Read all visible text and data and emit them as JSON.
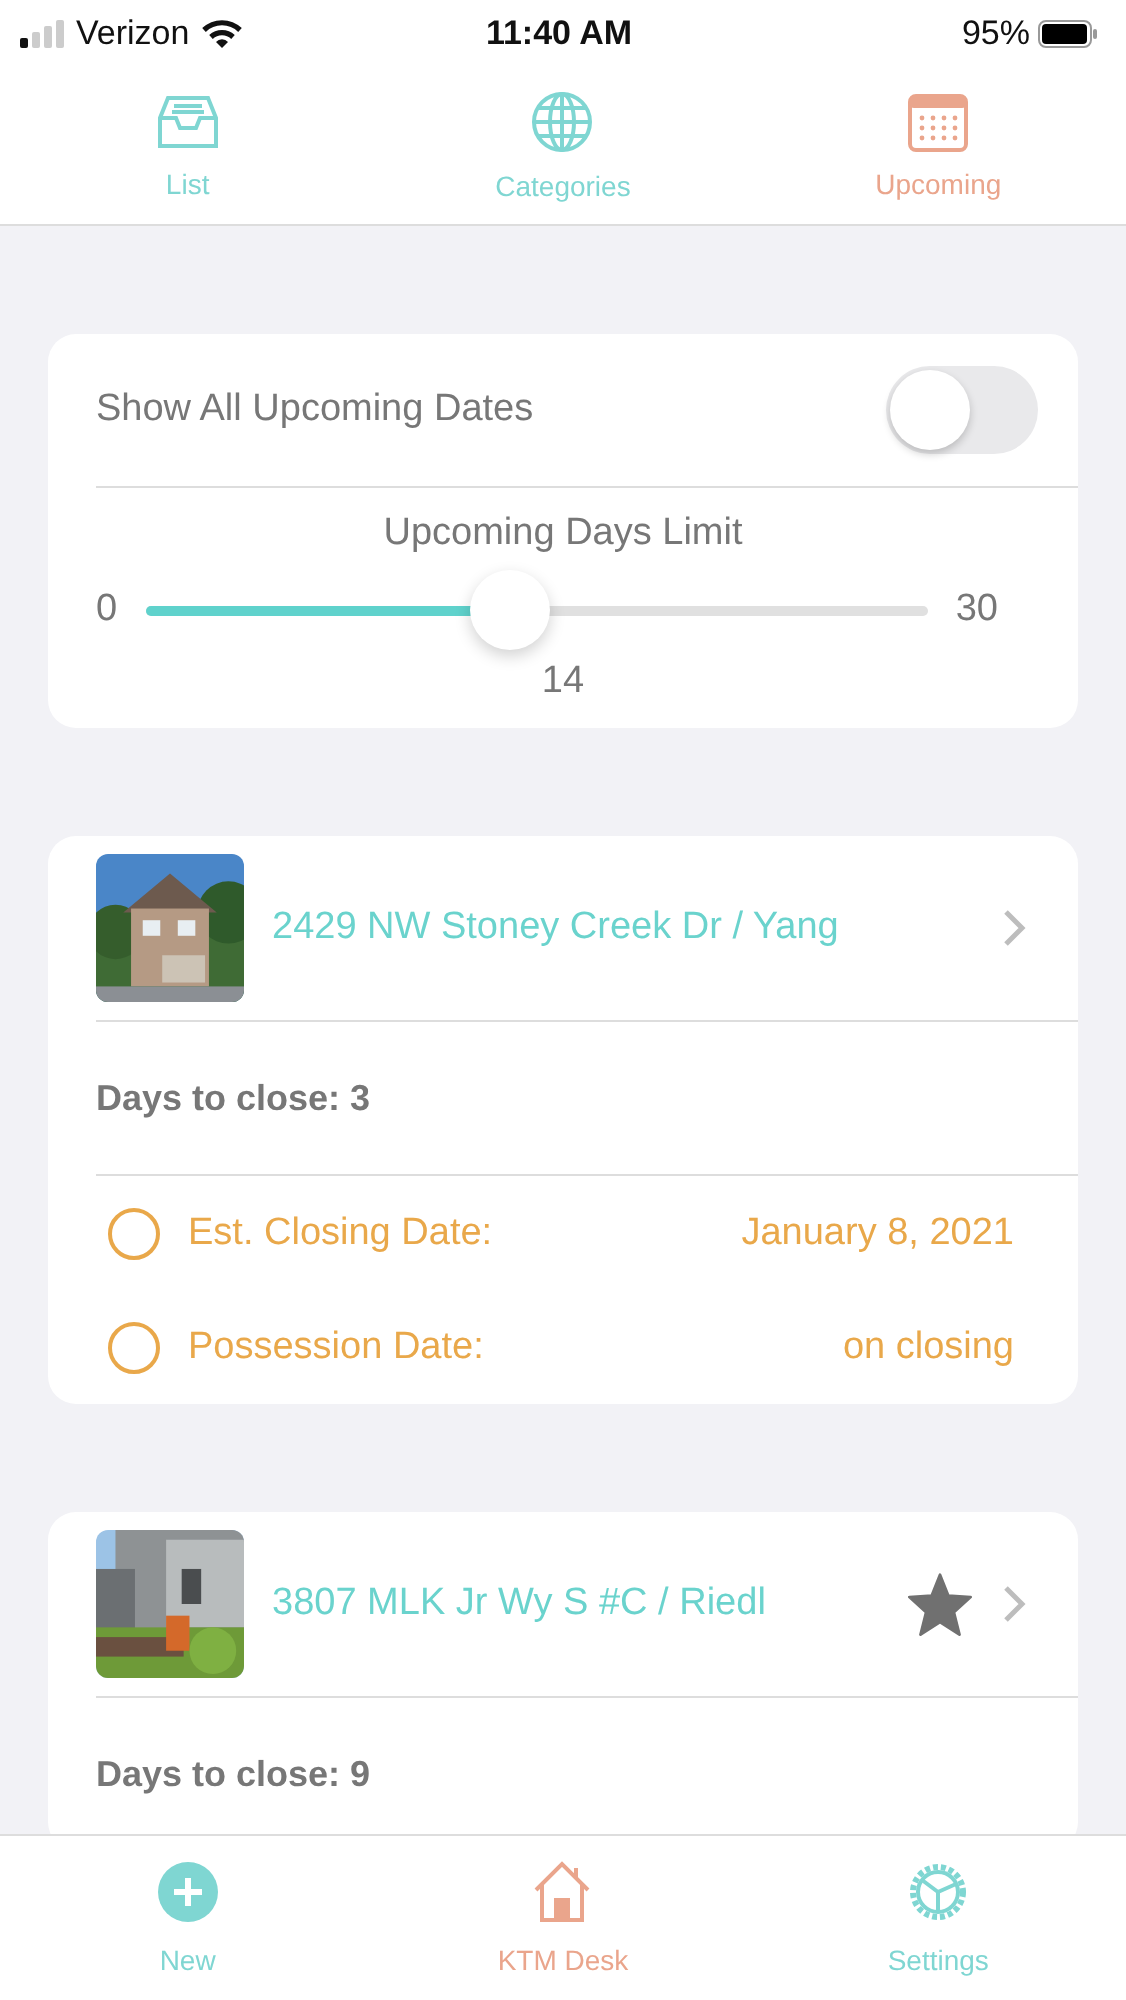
{
  "status_bar": {
    "carrier": "Verizon",
    "time": "11:40 AM",
    "battery": "95%"
  },
  "top_tabs": [
    {
      "label": "List",
      "selected": false
    },
    {
      "label": "Categories",
      "selected": false
    },
    {
      "label": "Upcoming",
      "selected": true
    }
  ],
  "settings": {
    "toggle_label": "Show All Upcoming Dates",
    "toggle_on": false,
    "slider_title": "Upcoming Days Limit",
    "min": "0",
    "max": "30",
    "level": 0.4667,
    "value": "14"
  },
  "listings": [
    {
      "title": "2429 NW Stoney Creek Dr / Yang",
      "starred": false,
      "days": "Days to close: 3",
      "dates": [
        {
          "label": "Est. Closing Date:",
          "value": "January 8, 2021",
          "checked": false
        },
        {
          "label": "Possession Date:",
          "value": "on closing",
          "checked": false
        }
      ]
    },
    {
      "title": "3807 MLK Jr Wy S #C / Riedl",
      "starred": true,
      "days": "Days to close: 9"
    }
  ],
  "bottom_tabs": [
    {
      "label": "New",
      "selected": false
    },
    {
      "label": "KTM Desk",
      "selected": true
    },
    {
      "label": "Settings",
      "selected": false
    }
  ]
}
